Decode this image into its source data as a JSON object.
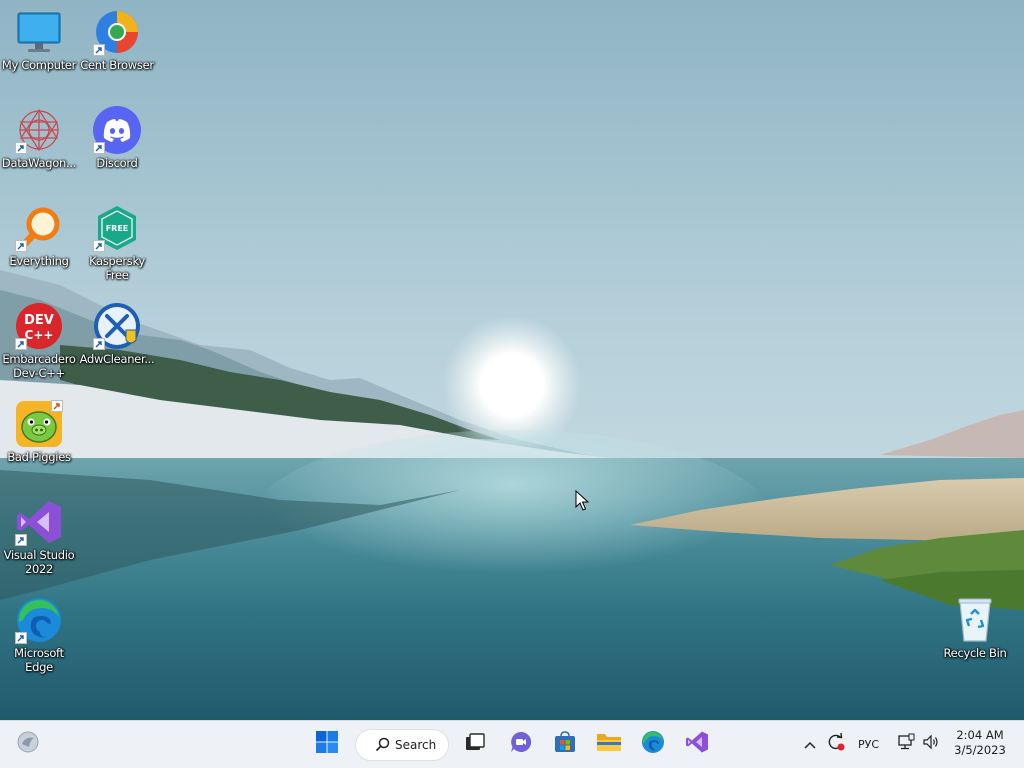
{
  "desktop": {
    "icons": [
      {
        "label": "My Computer",
        "icon": "monitor-icon"
      },
      {
        "label": "Cent Browser",
        "icon": "cent-browser-icon"
      },
      {
        "label": "DataWagon...",
        "icon": "datawagon-icon"
      },
      {
        "label": "Discord",
        "icon": "discord-icon"
      },
      {
        "label": "Everything",
        "icon": "everything-search-icon"
      },
      {
        "label": "Kaspersky\nFree",
        "icon": "kaspersky-shield-icon",
        "badge": "FREE"
      },
      {
        "label": "Embarcadero\nDev-C++",
        "icon": "devcpp-icon",
        "badge_top": "DEV",
        "badge_bottom": "C++"
      },
      {
        "label": "AdwCleaner...",
        "icon": "adwcleaner-icon"
      },
      {
        "label": "Bad Piggies",
        "icon": "bad-piggies-icon"
      },
      {
        "label": "Visual Studio\n2022",
        "icon": "visual-studio-icon"
      },
      {
        "label": "Microsoft\nEdge",
        "icon": "edge-icon"
      },
      {
        "label": "Recycle Bin",
        "icon": "recycle-bin-icon"
      }
    ]
  },
  "taskbar": {
    "search_label": "Search",
    "apps": [
      "widgets-icon",
      "start-icon",
      "search-icon",
      "task-view-icon",
      "teams-chat-icon",
      "store-icon",
      "file-explorer-icon",
      "edge-icon",
      "visual-studio-icon"
    ],
    "language": "РУС",
    "time": "2:04 AM",
    "date": "3/5/2023"
  },
  "colors": {
    "taskbar_bg": "#eef1f5",
    "start_blue": "#0a66d8",
    "discord": "#5865f2",
    "vs_purple": "#8c4fd8"
  }
}
